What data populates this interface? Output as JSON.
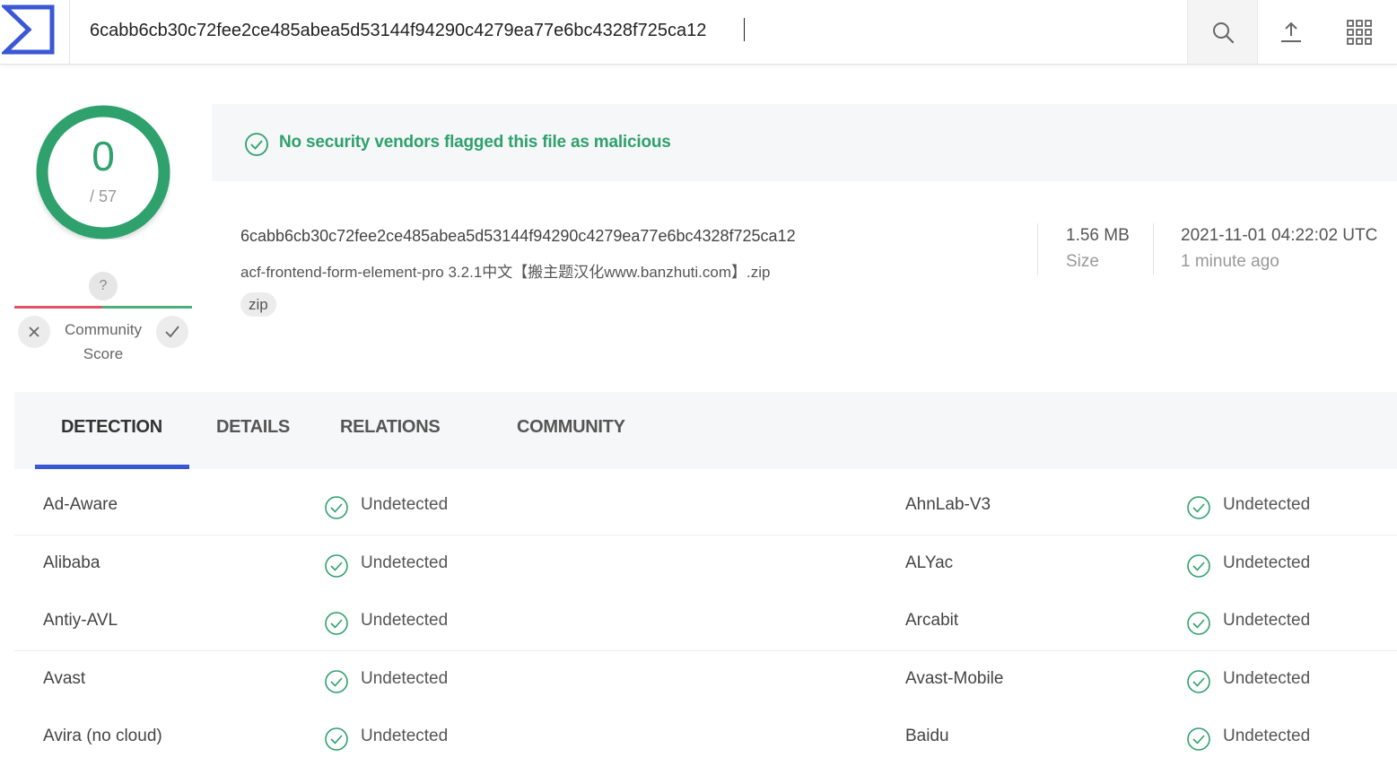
{
  "header": {
    "search_value": "6cabb6cb30c72fee2ce485abea5d53144f94290c4279ea77e6bc4328f725ca12"
  },
  "score": {
    "detections": "0",
    "total": "/ 57"
  },
  "community": {
    "question_mark": "?",
    "label_line1": "Community",
    "label_line2": "Score"
  },
  "banner": {
    "message": "No security vendors flagged this file as malicious"
  },
  "file": {
    "hash": "6cabb6cb30c72fee2ce485abea5d53144f94290c4279ea77e6bc4328f725ca12",
    "name": "acf-frontend-form-element-pro 3.2.1中文【搬主题汉化www.banzhuti.com】.zip",
    "tag": "zip",
    "size_value": "1.56 MB",
    "size_label": "Size",
    "date_value": "2021-11-01 04:22:02 UTC",
    "date_relative": "1 minute ago"
  },
  "tabs": [
    {
      "label": "DETECTION"
    },
    {
      "label": "DETAILS"
    },
    {
      "label": "RELATIONS"
    },
    {
      "label": "COMMUNITY"
    }
  ],
  "detections": [
    {
      "left_vendor": "Ad-Aware",
      "left_status": "Undetected",
      "right_vendor": "AhnLab-V3",
      "right_status": "Undetected"
    },
    {
      "left_vendor": "Alibaba",
      "left_status": "Undetected",
      "right_vendor": "ALYac",
      "right_status": "Undetected"
    },
    {
      "left_vendor": "Antiy-AVL",
      "left_status": "Undetected",
      "right_vendor": "Arcabit",
      "right_status": "Undetected"
    },
    {
      "left_vendor": "Avast",
      "left_status": "Undetected",
      "right_vendor": "Avast-Mobile",
      "right_status": "Undetected"
    },
    {
      "left_vendor": "Avira (no cloud)",
      "left_status": "Undetected",
      "right_vendor": "Baidu",
      "right_status": "Undetected"
    }
  ],
  "colors": {
    "accent": "#3a57d6",
    "clean_green": "#2ea16d",
    "negative_red": "#e05265"
  },
  "icons": {
    "logo": "sigma-logo-icon",
    "search": "search-icon",
    "upload": "upload-icon",
    "apps": "apps-grid-icon",
    "clean": "check-circle-icon"
  }
}
